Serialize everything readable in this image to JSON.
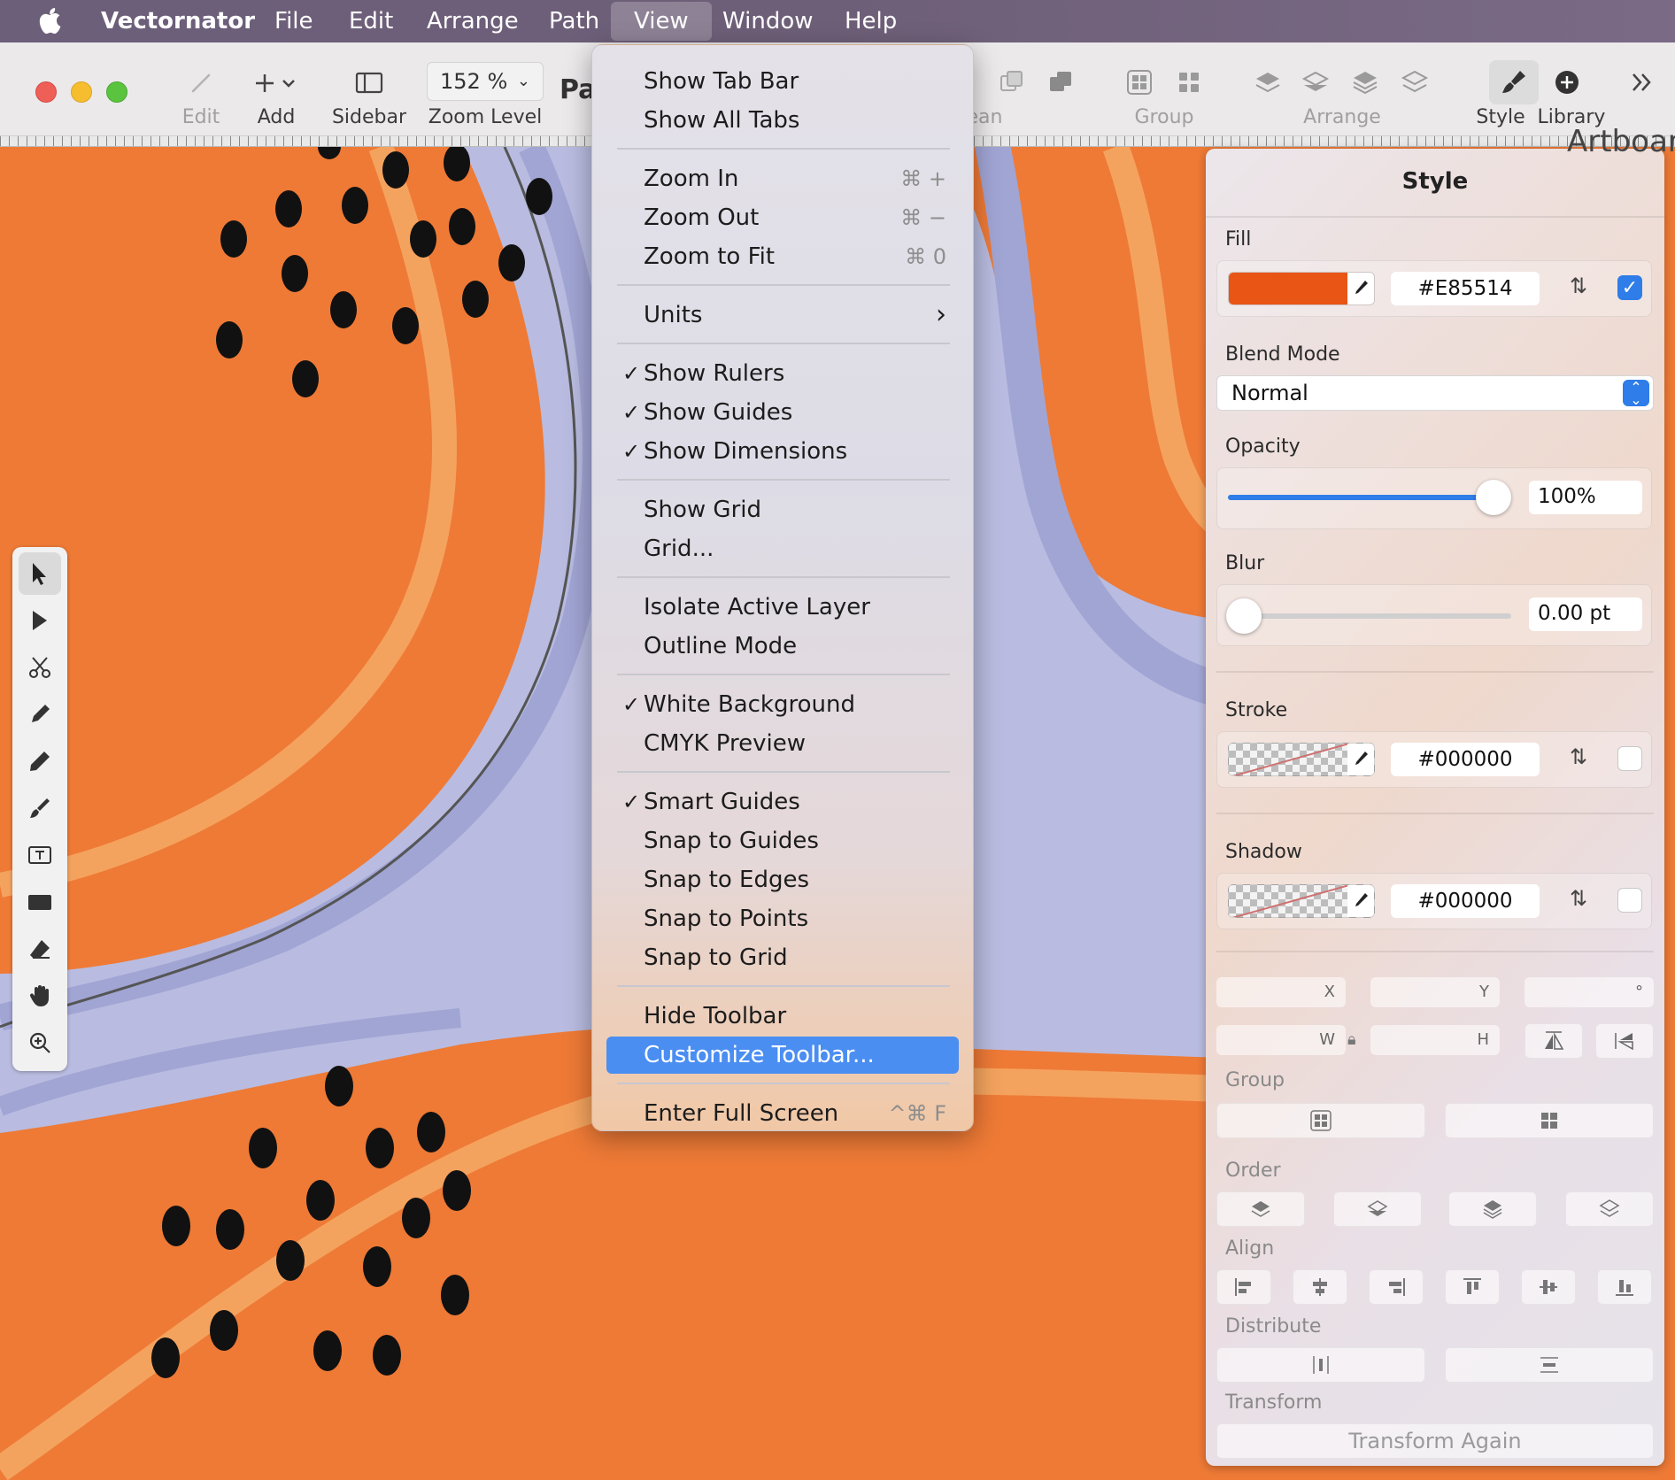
{
  "menubar": {
    "app_name": "Vectornator",
    "menus": [
      "File",
      "Edit",
      "Arrange",
      "Path",
      "View",
      "Window",
      "Help"
    ],
    "active_menu": "View"
  },
  "toolbar": {
    "edit_label": "Edit",
    "add_label": "Add",
    "sidebar_label": "Sidebar",
    "zoom_value": "152 %",
    "zoom_label": "Zoom Level",
    "partial_title": "Pa",
    "boolean_partial": "ean",
    "group_label": "Group",
    "arrange_label": "Arrange",
    "style_label": "Style",
    "library_label": "Library",
    "artboard_partial": "Artboar"
  },
  "view_menu": {
    "items": [
      {
        "label": "Show Tab Bar",
        "shortcut": "",
        "checked": false
      },
      {
        "label": "Show All Tabs",
        "shortcut": "",
        "checked": false
      },
      {
        "label": "Zoom In",
        "shortcut": "⌘ +",
        "checked": false
      },
      {
        "label": "Zoom Out",
        "shortcut": "⌘ −",
        "checked": false
      },
      {
        "label": "Zoom to Fit",
        "shortcut": "⌘ 0",
        "checked": false
      },
      {
        "label": "Units",
        "shortcut": "›",
        "checked": false
      },
      {
        "label": "Show Rulers",
        "shortcut": "",
        "checked": true
      },
      {
        "label": "Show Guides",
        "shortcut": "",
        "checked": true
      },
      {
        "label": "Show Dimensions",
        "shortcut": "",
        "checked": true
      },
      {
        "label": "Show Grid",
        "shortcut": "",
        "checked": false
      },
      {
        "label": "Grid...",
        "shortcut": "",
        "checked": false
      },
      {
        "label": "Isolate Active Layer",
        "shortcut": "",
        "checked": false
      },
      {
        "label": "Outline Mode",
        "shortcut": "",
        "checked": false
      },
      {
        "label": "White Background",
        "shortcut": "",
        "checked": true
      },
      {
        "label": "CMYK Preview",
        "shortcut": "",
        "checked": false
      },
      {
        "label": "Smart Guides",
        "shortcut": "",
        "checked": true
      },
      {
        "label": "Snap to Guides",
        "shortcut": "",
        "checked": false
      },
      {
        "label": "Snap to Edges",
        "shortcut": "",
        "checked": false
      },
      {
        "label": "Snap to Points",
        "shortcut": "",
        "checked": false
      },
      {
        "label": "Snap to Grid",
        "shortcut": "",
        "checked": false
      },
      {
        "label": "Hide Toolbar",
        "shortcut": "",
        "checked": false
      },
      {
        "label": "Customize Toolbar...",
        "shortcut": "",
        "checked": false,
        "highlighted": true
      },
      {
        "label": "Enter Full Screen",
        "shortcut": "^⌘ F",
        "checked": false
      }
    ],
    "check_glyph": "✓"
  },
  "style_panel": {
    "title": "Style",
    "fill": {
      "label": "Fill",
      "hex": "#E85514",
      "color": "#E85514",
      "enabled": true
    },
    "blend_mode": {
      "label": "Blend Mode",
      "value": "Normal"
    },
    "opacity": {
      "label": "Opacity",
      "value": "100%",
      "level": 1.0
    },
    "blur": {
      "label": "Blur",
      "value": "0.00 pt",
      "level": 0.0
    },
    "stroke": {
      "label": "Stroke",
      "hex": "#000000",
      "enabled": false
    },
    "shadow": {
      "label": "Shadow",
      "hex": "#000000",
      "enabled": false
    },
    "geometry": {
      "x_label": "X",
      "y_label": "Y",
      "angle_label": "°",
      "w_label": "W",
      "h_label": "H"
    },
    "group_label": "Group",
    "order_label": "Order",
    "align_label": "Align",
    "distribute_label": "Distribute",
    "transform_label": "Transform",
    "transform_again": "Transform Again"
  },
  "colors": {
    "canvas_orange": "#EE7A36",
    "stripe_light_orange": "#F4A35E",
    "lavender": "#B9BCE0",
    "lavender_dark": "#9FA3D3",
    "menu_highlight": "#4A8EF2",
    "accent_blue": "#2F7DE8"
  }
}
